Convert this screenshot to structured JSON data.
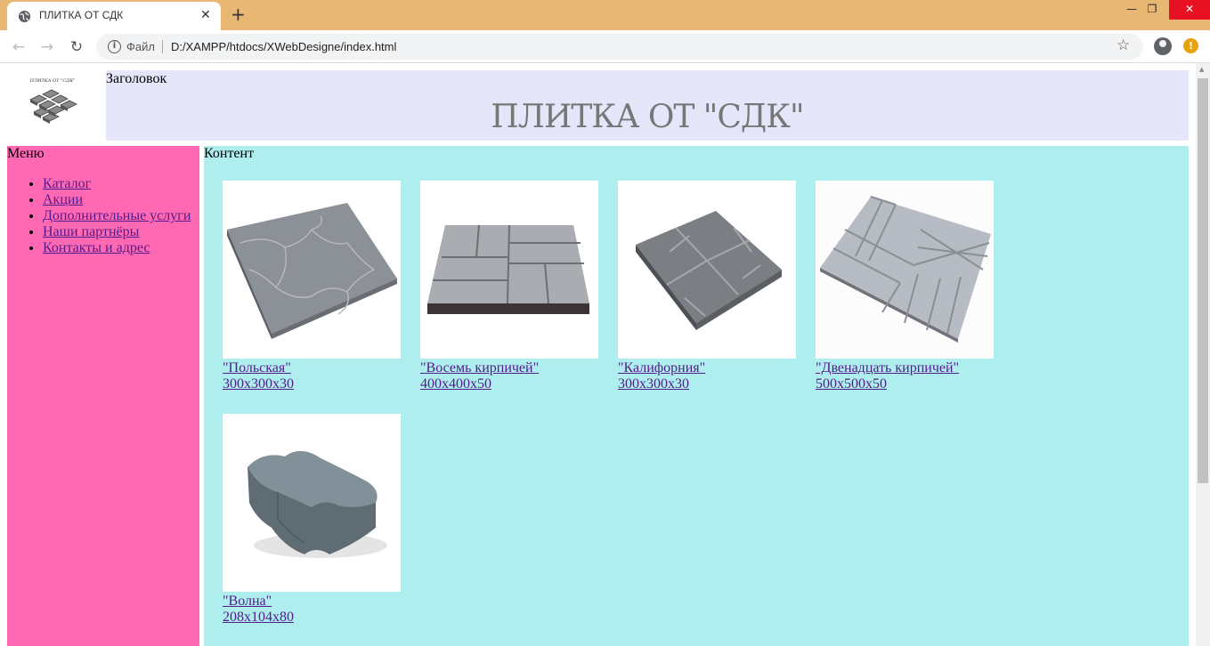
{
  "browser": {
    "tab_title": "ПЛИТКА ОТ СДК",
    "file_label": "Файл",
    "url": "D:/XAMPP/htdocs/XWebDesigne/index.html"
  },
  "page": {
    "logo_text": "ПЛИТКА ОТ \"СДК\"",
    "header_label": "Заголовок",
    "header_title": "ПЛИТКА ОТ \"СДК\"",
    "menu_label": "Меню",
    "menu_items": [
      {
        "label": "Каталог"
      },
      {
        "label": "Акции"
      },
      {
        "label": "Дополнительные услуги"
      },
      {
        "label": "Наши партнёры"
      },
      {
        "label": "Контакты и адрес"
      }
    ],
    "content_label": "Контент",
    "products": [
      {
        "name": "\"Польская\"",
        "size": "300x300x30"
      },
      {
        "name": "\"Восемь кирпичей\"",
        "size": "400x400x50"
      },
      {
        "name": "\"Калифорния\"",
        "size": "300x300x30"
      },
      {
        "name": "\"Двенадцать кирпичей\"",
        "size": "500x500x50"
      },
      {
        "name": "\"Волна\"",
        "size": "208x104x80"
      }
    ]
  },
  "colors": {
    "titlebar": "#e8b774",
    "header_bg": "#e6e6fa",
    "menu_bg": "#ff69b4",
    "content_bg": "#afeeee",
    "link": "#551a8b"
  },
  "icons": [
    "globe-icon",
    "close-icon",
    "plus-icon",
    "back-arrow-icon",
    "forward-arrow-icon",
    "reload-icon",
    "info-icon",
    "star-icon",
    "profile-icon",
    "alert-icon"
  ]
}
